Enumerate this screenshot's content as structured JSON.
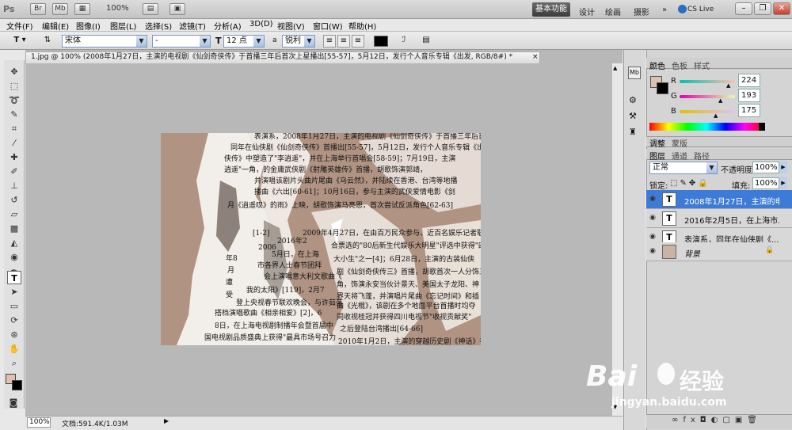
{
  "appbar": {
    "logo": "Ps",
    "icons": [
      "Br",
      "Mb"
    ],
    "zoom": "100%",
    "workspaces": {
      "active": "基本功能",
      "others": [
        "设计",
        "绘画",
        "摄影"
      ]
    },
    "cslive": "CS Live"
  },
  "menu": [
    "文件(F)",
    "编辑(E)",
    "图像(I)",
    "图层(L)",
    "选择(S)",
    "滤镜(T)",
    "分析(A)",
    "3D(D)",
    "视图(V)",
    "窗口(W)",
    "帮助(H)"
  ],
  "options": {
    "font_family": "宋体",
    "font_style": "-",
    "font_size": "12 点",
    "antialias_prefix": "a",
    "antialias": "锐利"
  },
  "document": {
    "tab_title": "1.jpg @ 100% (2008年1月27日，主演的电视剧《仙剑奇侠传》于首播三年后首次上星播出[55-57]，5月12日，发行个人音乐专辑《出发, RGB/8#) *"
  },
  "canvas_text": [
    "表演系，2008年1月27日，主演的电视剧《仙剑奇侠传》于首播三年后首",
    "同年在仙侠剧《仙剑奇侠传》首播出[55-57]，5月12日，发行个人音乐专辑《出",
    "侠传》中塑造了\"李逍遥\"，并在上海举行首唱会[58-59]；7月19日，主演",
    "逍遥\"一角，的金庸武侠剧《射雕英雄传》首播，胡歌饰演郭靖，",
    "并演唱该剧片头曲片尾曲《乌云然》，并陆续在香港、台湾等地播",
    "播曲《六出[60-61]；10月16日，参与主演的武侠爱情电影《剑",
    "月《逍遥叹》的雨》上映，胡歌饰演马亮恩，首次尝试反派角色[62-63]",
    "[1-2]",
    "2009年4月27日，在由百万民众参与、近百名娱乐记者联",
    "2016年2",
    "合票选的\"80后新生代娱乐大明星\"评选中获得\"四",
    "2006",
    "5月日，在上海",
    "大小生\"之一[4]；6月28日，主演的古装仙侠",
    "年8",
    "市各界人士春节团拜",
    "剧《仙剑奇侠传三》首播，胡歌首次一人分饰三",
    "月",
    "会上演唱意大利文歌曲《",
    "角，饰演永安当伙计景天、美国太子龙阳、神",
    "遭",
    "我的太阳》[119]，2月7",
    "界天将飞蓬，并演唱片尾曲《忘记时间》和插",
    "受",
    "登上央视春节联欢晚会，与许茹芸",
    "曲《光棍》，该剧在多个地面平台首播时均夺",
    "搭档演唱歌曲《相亲相爱》[2]，6",
    "同收视桂冠并获得四川电视节\"收视贡献奖\"",
    "8日，在上海电视剧制播年会暨首届中",
    "之后登陆台湾播出[64-66]",
    "国电视剧品质盛典上获得\"最具市场号召力",
    "2010年1月2日，主演的穿越历史剧《神话》在"
  ],
  "status": {
    "zoom": "100%",
    "doc": "文档:591.4K/1.03M"
  },
  "color_panel": {
    "tabs": [
      "颜色",
      "色板",
      "样式"
    ],
    "r_label": "R",
    "g_label": "G",
    "b_label": "B",
    "r": "224",
    "g": "193",
    "b": "175",
    "foreground": "#e0c1af",
    "background": "#000000"
  },
  "adjust_tabs": [
    "调整",
    "蒙版"
  ],
  "layers_panel": {
    "tabs": [
      "图层",
      "通道",
      "路径"
    ],
    "blend_mode": "正常",
    "opacity_label": "不透明度:",
    "opacity": "100%",
    "lock_label": "锁定:",
    "fill_label": "填充:",
    "fill": "100%",
    "layers": [
      {
        "name": "2008年1月27日，主演的电...",
        "thumb": "T",
        "selected": true
      },
      {
        "name": "2016年2月5日，在上海市...",
        "thumb": "T",
        "selected": false
      },
      {
        "name": "表演系，同年在仙侠剧《...",
        "thumb": "T",
        "selected": false
      },
      {
        "name": "背景",
        "thumb": "",
        "selected": false
      }
    ]
  },
  "watermark": {
    "brand": "Bai",
    "brand2": "经验",
    "url": "jingyan.baidu.com"
  }
}
